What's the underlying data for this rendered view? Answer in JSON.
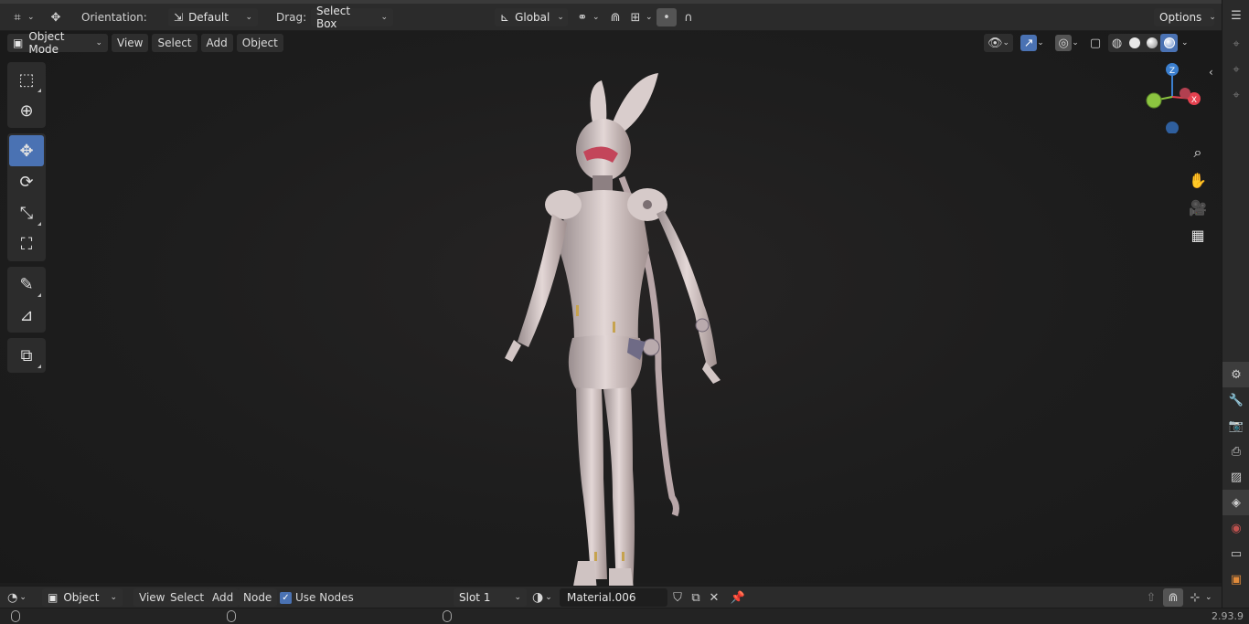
{
  "header": {
    "orientation_label": "Orientation:",
    "orientation_value": "Default",
    "drag_label": "Drag:",
    "drag_value": "Select Box",
    "transform_pivot": "Global",
    "options_label": "Options"
  },
  "viewport_header": {
    "mode": "Object Mode",
    "menus": [
      "View",
      "Select",
      "Add",
      "Object"
    ]
  },
  "toolbar": {
    "tools": [
      {
        "name": "select-box-icon",
        "glyph": "⬚"
      },
      {
        "name": "cursor-icon",
        "glyph": "⊕"
      },
      {
        "name": "move-icon",
        "glyph": "✥"
      },
      {
        "name": "rotate-icon",
        "glyph": "⟳"
      },
      {
        "name": "scale-icon",
        "glyph": "⤡"
      },
      {
        "name": "transform-icon",
        "glyph": "⛶"
      },
      {
        "name": "annotate-icon",
        "glyph": "✎"
      },
      {
        "name": "measure-icon",
        "glyph": "📐"
      },
      {
        "name": "add-cube-icon",
        "glyph": "⧉"
      }
    ],
    "active_index": 2
  },
  "gizmo": {
    "x_label": "X",
    "z_label": "Z",
    "x_color": "#e5414f",
    "y_color": "#8cc540",
    "z_color": "#3b7fcf"
  },
  "bottom_editor": {
    "mode": "Object",
    "menus": [
      "View",
      "Select",
      "Add",
      "Node"
    ],
    "use_nodes_label": "Use Nodes",
    "use_nodes_checked": true,
    "slot": "Slot 1",
    "material": "Material.006"
  },
  "status": {
    "version": "2.93.9"
  },
  "colors": {
    "accent": "#4a72b3",
    "background": "#1d1d1d"
  }
}
